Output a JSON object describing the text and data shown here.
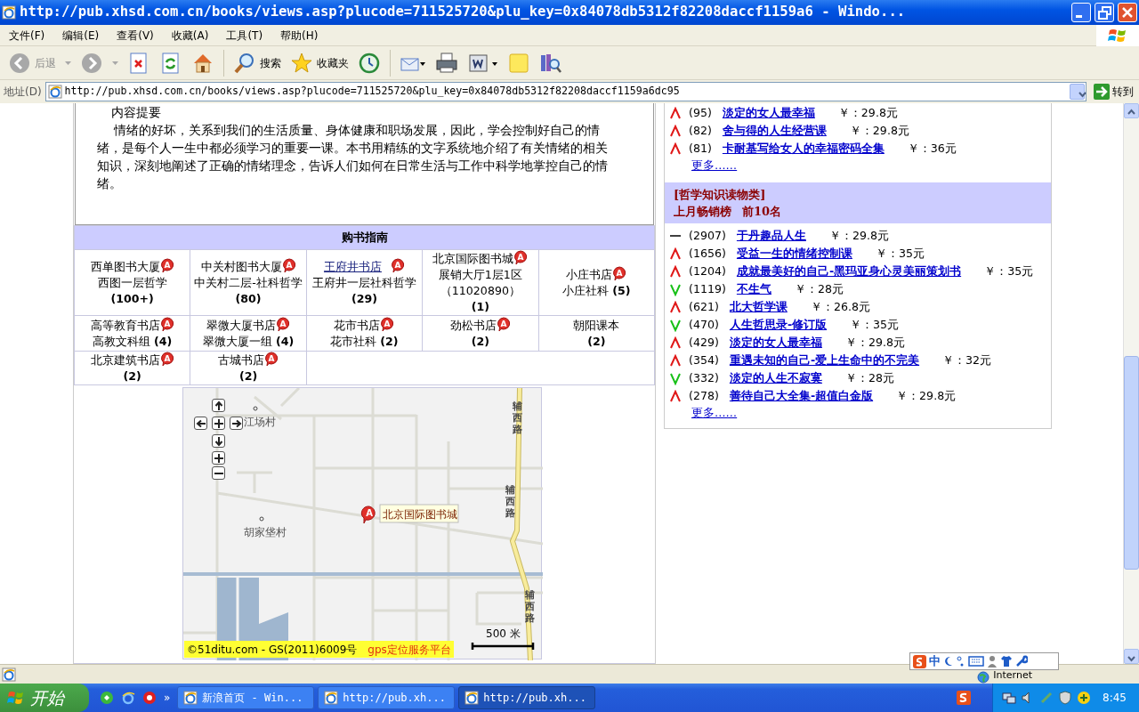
{
  "window": {
    "title": "http://pub.xhsd.com.cn/books/views.asp?plucode=711525720&plu_key=0x84078db5312f82208daccf1159a6 - Windo..."
  },
  "menu": [
    "文件(F)",
    "编辑(E)",
    "查看(V)",
    "收藏(A)",
    "工具(T)",
    "帮助(H)"
  ],
  "toolbar": [
    {
      "kind": "back",
      "label": "后退",
      "disabled": true
    },
    {
      "kind": "forward",
      "disabled": true
    },
    {
      "kind": "stop",
      "disabled": false
    },
    {
      "kind": "refresh",
      "disabled": false
    },
    {
      "kind": "home",
      "disabled": false
    },
    {
      "kind": "search",
      "label": "搜索",
      "disabled": false
    },
    {
      "kind": "favorites",
      "label": "收藏夹",
      "disabled": false
    },
    {
      "kind": "history",
      "disabled": false
    },
    {
      "kind": "mail",
      "disabled": false
    },
    {
      "kind": "print",
      "disabled": false
    },
    {
      "kind": "edit",
      "disabled": false
    },
    {
      "kind": "notes",
      "disabled": false
    },
    {
      "kind": "research",
      "disabled": false
    }
  ],
  "address": {
    "label": "地址(D)",
    "url": "http://pub.xhsd.com.cn/books/views.asp?plucode=711525720&plu_key=0x84078db5312f82208daccf1159a6dc95",
    "go": "转到"
  },
  "summary": {
    "heading": "内容提要",
    "text": "情绪的好坏，关系到我们的生活质量、身体健康和职场发展，因此，学会控制好自己的情绪，是每个人一生中都必须学习的重要一课。本书用精练的文字系统地介绍了有关情绪的相关知识，深刻地阐述了正确的情绪理念，告诉人们如何在日常生活与工作中科学地掌控自己的情绪。"
  },
  "guide": {
    "title": "购书指南",
    "stores": [
      {
        "name": "西单图书大厦",
        "marker": "A",
        "location": "西图一层哲学",
        "count": "(100+)",
        "link": false
      },
      {
        "name": "中关村图书大厦",
        "marker": "A",
        "location": "中关村二层-社科哲学",
        "count": "(80)",
        "link": false
      },
      {
        "name": "王府井书店",
        "marker": "A",
        "location": "王府井一层社科哲学",
        "count": "(29)",
        "link": true
      },
      {
        "name": "北京国际图书城",
        "marker": "A",
        "location": "展销大厅1层1区（11020890）",
        "count": "(1)",
        "link": false
      },
      {
        "name": "小庄书店",
        "marker": "A",
        "location": "小庄社科",
        "count": "(5)",
        "link": false
      },
      {
        "name": "高等教育书店",
        "marker": "A",
        "location": "高教文科组",
        "count": "(4)",
        "link": false
      },
      {
        "name": "翠微大厦书店",
        "marker": "A",
        "location": "翠微大厦一组",
        "count": "(4)",
        "link": false
      },
      {
        "name": "花市书店",
        "marker": "A",
        "location": "花市社科",
        "count": "(2)",
        "link": false
      },
      {
        "name": "劲松书店",
        "marker": "A",
        "count": "(2)",
        "link": false
      },
      {
        "name": "朝阳课本",
        "count": "(2)",
        "link": false
      },
      {
        "name": "北京建筑书店",
        "marker": "A",
        "count": "(2)",
        "link": false
      },
      {
        "name": "古城书店",
        "marker": "A",
        "count": "(2)",
        "link": false
      }
    ]
  },
  "map": {
    "places": [
      "江场村",
      "胡家垡村"
    ],
    "roads": [
      "辅西路",
      "辅西路",
      "辅西路"
    ],
    "pin": {
      "letter": "A",
      "label": "北京国际图书城"
    },
    "scale": "500 米",
    "copyright": "©51ditu.com - GS(2011)6009号",
    "platform": "gps定位服务平台"
  },
  "rankings": {
    "top_rows": [
      {
        "kind": "up",
        "count": "(95)",
        "title": "淡定的女人最幸福",
        "price": "￥：29.8元"
      },
      {
        "kind": "up",
        "count": "(82)",
        "title": "舍与得的人生经营课",
        "price": "￥：29.8元"
      },
      {
        "kind": "up",
        "count": "(81)",
        "title": "卡耐基写给女人的幸福密码全集",
        "price": "￥：36元"
      }
    ],
    "top_more": "更多……",
    "category": "[哲学知识读物类]",
    "subtitle": "上月畅销榜",
    "subtitle_count": "前10名",
    "rows": [
      {
        "kind": "same",
        "count": "(2907)",
        "title": "于丹趣品人生",
        "price": "￥：29.8元"
      },
      {
        "kind": "up",
        "count": "(1656)",
        "title": "受益一生的情绪控制课",
        "price": "￥：35元"
      },
      {
        "kind": "up",
        "count": "(1204)",
        "title": "成就最美好的自己-黑玛亚身心灵美丽策划书",
        "price": "￥：35元"
      },
      {
        "kind": "down",
        "count": "(1119)",
        "title": "不生气",
        "price": "￥：28元"
      },
      {
        "kind": "up",
        "count": "(621)",
        "title": "北大哲学课",
        "price": "￥：26.8元"
      },
      {
        "kind": "down",
        "count": "(470)",
        "title": "人生哲思录-修订版",
        "price": "￥：35元"
      },
      {
        "kind": "up",
        "count": "(429)",
        "title": "淡定的女人最幸福",
        "price": "￥：29.8元"
      },
      {
        "kind": "up",
        "count": "(354)",
        "title": "重遇未知的自己-爱上生命中的不完美",
        "price": "￥：32元"
      },
      {
        "kind": "down",
        "count": "(332)",
        "title": "淡定的人生不寂寞",
        "price": "￥：28元"
      },
      {
        "kind": "up",
        "count": "(278)",
        "title": "善待自己大全集-超值白金版",
        "price": "￥：29.8元"
      }
    ],
    "more": "更多……"
  },
  "status": {
    "zone": "Internet"
  },
  "ime": {
    "label": "中"
  },
  "taskbar": {
    "start": "开始",
    "more": "»",
    "tasks": [
      {
        "label": "新浪首页 - Win...",
        "selected": false
      },
      {
        "label": "http://pub.xh...",
        "selected": false
      },
      {
        "label": "http://pub.xh...",
        "selected": true
      }
    ],
    "clock": "8:45"
  }
}
